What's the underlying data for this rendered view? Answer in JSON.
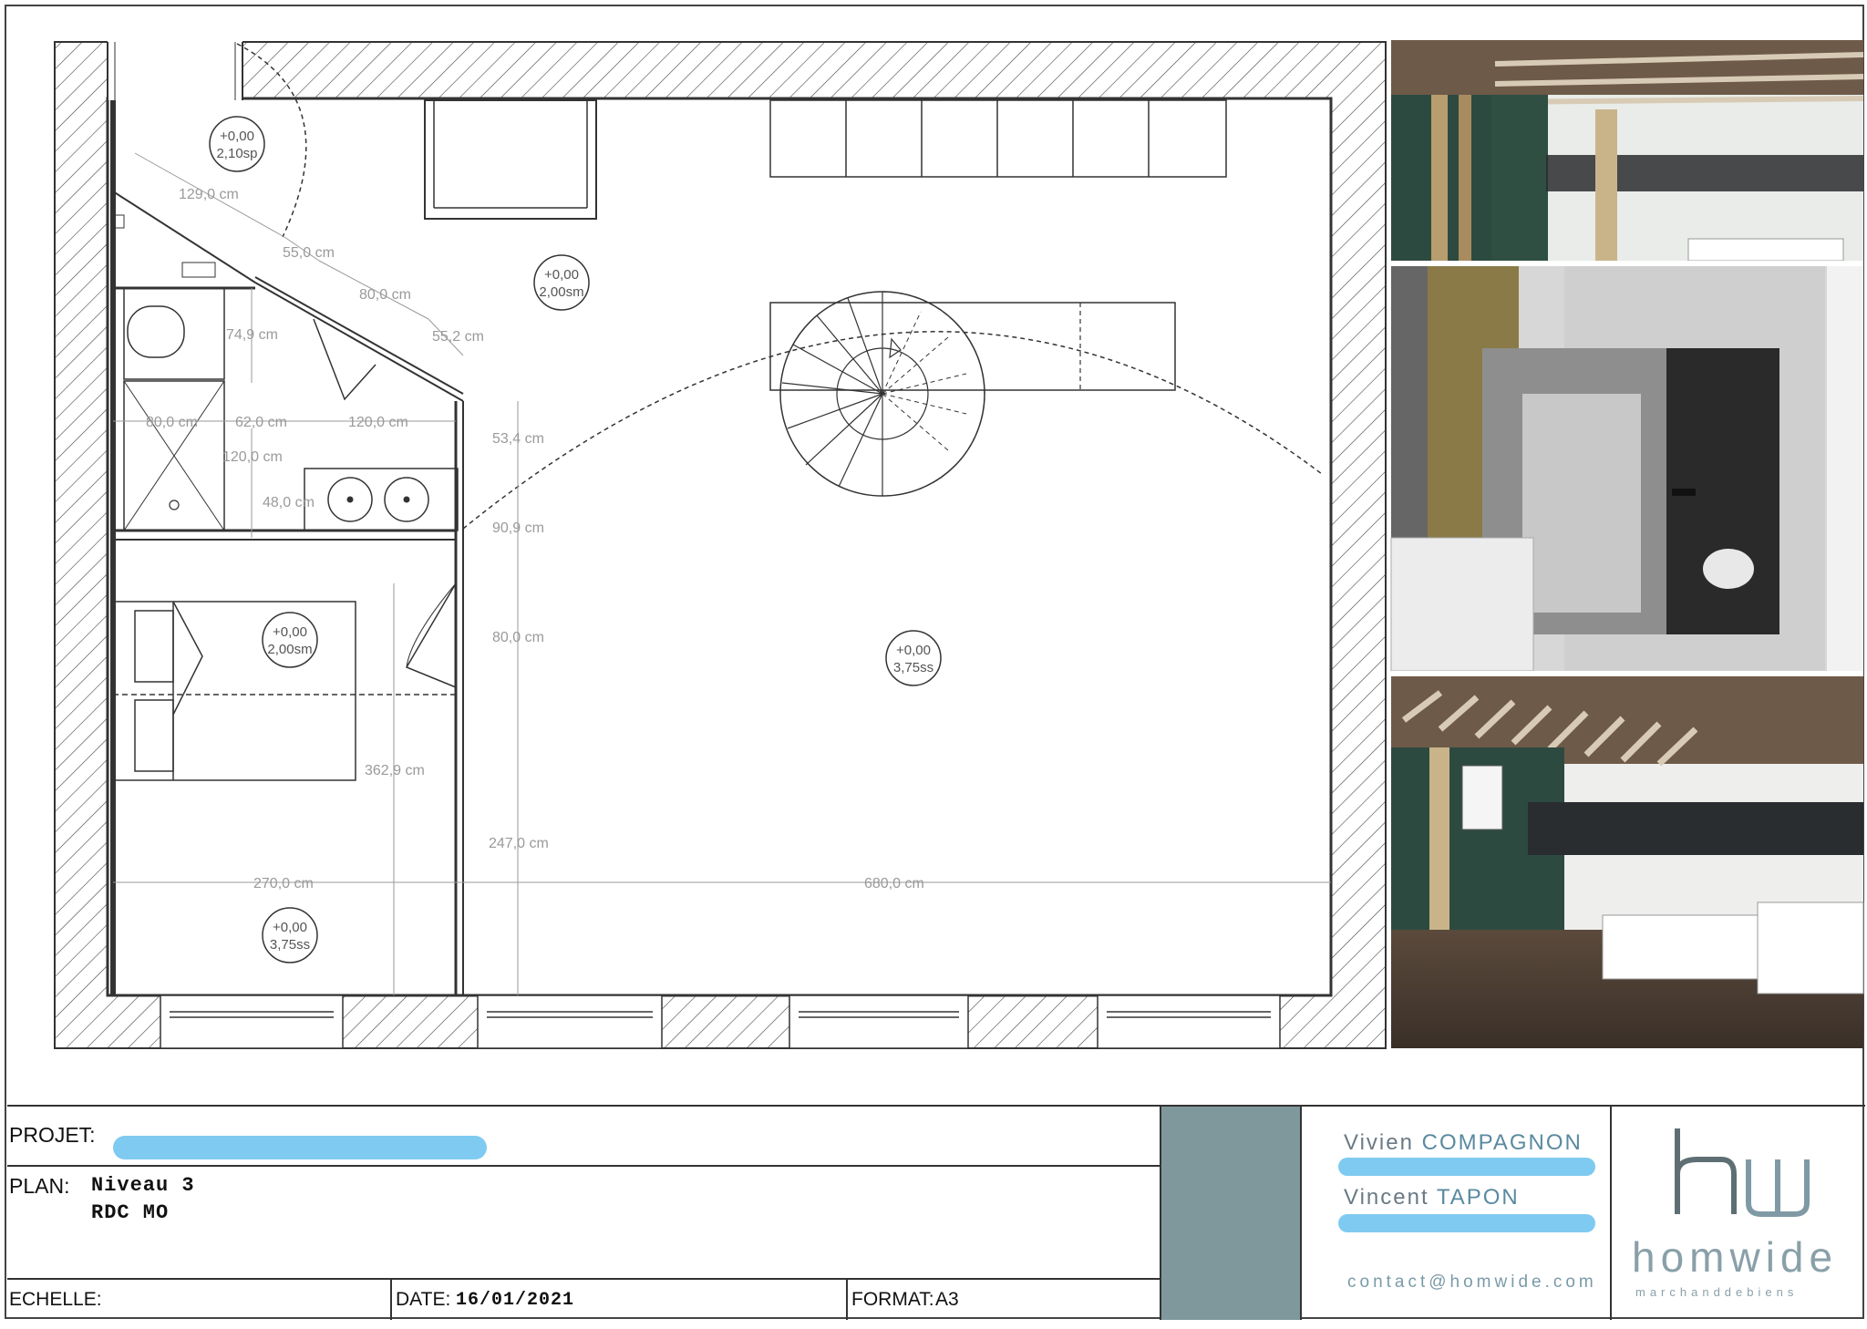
{
  "plan": {
    "dimensions": [
      "129,0 cm",
      "55,0 cm",
      "80,0 cm",
      "55,2 cm",
      "74,9 cm",
      "80,0 cm",
      "62,0 cm",
      "120,0 cm",
      "120,0 cm",
      "48,0 cm",
      "53,4 cm",
      "90,9 cm",
      "80,0 cm",
      "362,9 cm",
      "247,0 cm",
      "270,0 cm",
      "680,0 cm"
    ],
    "levels": [
      {
        "top": "+0,00",
        "bottom": "2,10sp"
      },
      {
        "top": "+0,00",
        "bottom": "2,00sm"
      },
      {
        "top": "+0,00",
        "bottom": "2,00sm"
      },
      {
        "top": "+0,00",
        "bottom": "3,75ss"
      },
      {
        "top": "+0,00",
        "bottom": "3,75ss"
      }
    ]
  },
  "renders": [
    {
      "name": "mezzanine-render"
    },
    {
      "name": "bathroom-render"
    },
    {
      "name": "living-room-render"
    }
  ],
  "title_block": {
    "projet_label": "PROJET:",
    "plan_label": "PLAN:",
    "plan_line1": "Niveau 3",
    "plan_line2": "RDC MO",
    "echelle_label": "ECHELLE:",
    "date_label": "DATE:",
    "date_value": "16/01/2021",
    "format_label": "FORMAT:",
    "format_value": "A3",
    "accent_color": "#7f989c",
    "contact1_first": "Vivien",
    "contact1_last": "COMPAGNON",
    "contact2_first": "Vincent",
    "contact2_last": "TAPON",
    "email": "contact@homwide.com",
    "brand_name": "homwide",
    "brand_tagline": "marchanddebiens"
  }
}
